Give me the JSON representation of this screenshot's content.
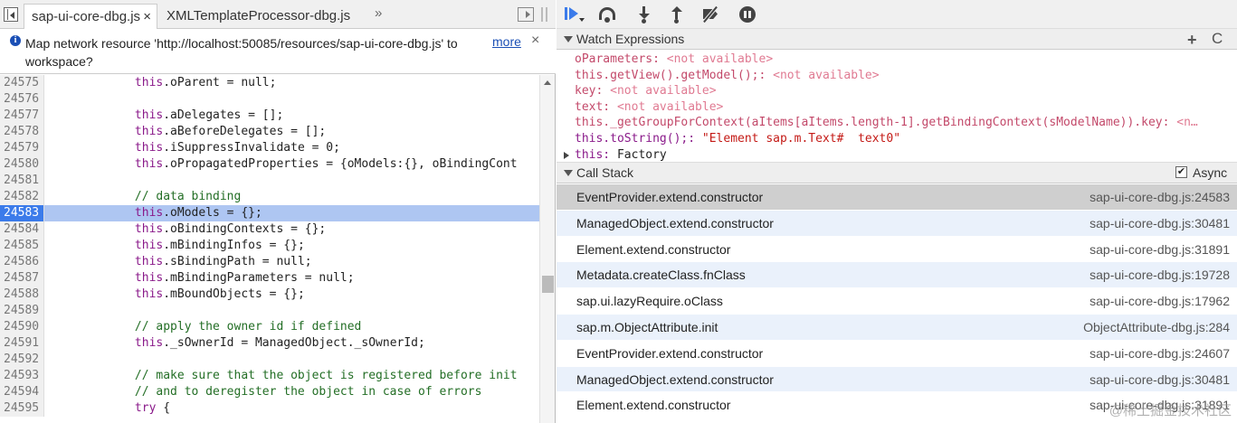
{
  "editor": {
    "tabs": [
      {
        "label": "sap-ui-core-dbg.js",
        "close": "×"
      },
      {
        "label": "XMLTemplateProcessor-dbg.js"
      }
    ],
    "more_tabs": "»",
    "infobar": {
      "message": "Map network resource 'http://localhost:50085/resources/sap-ui-core-dbg.js' to workspace?",
      "more_link": "more",
      "close": "×"
    },
    "highlighted_line": "24583",
    "lines": [
      {
        "n": "24575",
        "code": "            this.oParent = null;"
      },
      {
        "n": "24576",
        "code": ""
      },
      {
        "n": "24577",
        "code": "            this.aDelegates = [];"
      },
      {
        "n": "24578",
        "code": "            this.aBeforeDelegates = [];"
      },
      {
        "n": "24579",
        "code": "            this.iSuppressInvalidate = 0;"
      },
      {
        "n": "24580",
        "code": "            this.oPropagatedProperties = {oModels:{}, oBindingCont"
      },
      {
        "n": "24581",
        "code": ""
      },
      {
        "n": "24582",
        "code": "            // data binding"
      },
      {
        "n": "24583",
        "code": "            this.oModels = {};"
      },
      {
        "n": "24584",
        "code": "            this.oBindingContexts = {};"
      },
      {
        "n": "24585",
        "code": "            this.mBindingInfos = {};"
      },
      {
        "n": "24586",
        "code": "            this.sBindingPath = null;"
      },
      {
        "n": "24587",
        "code": "            this.mBindingParameters = null;"
      },
      {
        "n": "24588",
        "code": "            this.mBoundObjects = {};"
      },
      {
        "n": "24589",
        "code": ""
      },
      {
        "n": "24590",
        "code": "            // apply the owner id if defined"
      },
      {
        "n": "24591",
        "code": "            this._sOwnerId = ManagedObject._sOwnerId;"
      },
      {
        "n": "24592",
        "code": ""
      },
      {
        "n": "24593",
        "code": "            // make sure that the object is registered before init"
      },
      {
        "n": "24594",
        "code": "            // and to deregister the object in case of errors"
      },
      {
        "n": "24595",
        "code": "            try {"
      }
    ]
  },
  "debugger_toolbar": {
    "buttons": [
      {
        "icon": "resume-icon"
      },
      {
        "icon": "step-over-icon"
      },
      {
        "icon": "step-into-icon"
      },
      {
        "icon": "step-out-icon"
      },
      {
        "icon": "deactivate-breakpoints-icon"
      },
      {
        "icon": "pause-on-exceptions-icon"
      }
    ]
  },
  "watch": {
    "title": "Watch Expressions",
    "add": "+",
    "refresh": "C",
    "items": [
      {
        "expr": "oParameters:",
        "value": " <not available>",
        "status": "na"
      },
      {
        "expr": "this.getView().getModel();:",
        "value": " <not available>",
        "status": "na"
      },
      {
        "expr": "key:",
        "value": " <not available>",
        "status": "na"
      },
      {
        "expr": "text:",
        "value": " <not available>",
        "status": "na"
      },
      {
        "expr": "this._getGroupForContext(aItems[aItems.length-1].getBindingContext(sModelName)).key:",
        "value": " <n…",
        "status": "na"
      },
      {
        "expr": "this.toString();:",
        "value": " \"Element sap.m.Text#  text0\"",
        "status": "ok"
      },
      {
        "expr": "this:",
        "value": " Factory",
        "status": "obj"
      }
    ]
  },
  "call_stack": {
    "title": "Call Stack",
    "async_label": "Async",
    "async_checked": true,
    "frames": [
      {
        "name": "EventProvider.extend.constructor",
        "location": "sap-ui-core-dbg.js:24583",
        "selected": true
      },
      {
        "name": "ManagedObject.extend.constructor",
        "location": "sap-ui-core-dbg.js:30481"
      },
      {
        "name": "Element.extend.constructor",
        "location": "sap-ui-core-dbg.js:31891"
      },
      {
        "name": "Metadata.createClass.fnClass",
        "location": "sap-ui-core-dbg.js:19728"
      },
      {
        "name": "sap.ui.lazyRequire.oClass",
        "location": "sap-ui-core-dbg.js:17962"
      },
      {
        "name": "sap.m.ObjectAttribute.init",
        "location": "ObjectAttribute-dbg.js:284"
      },
      {
        "name": "EventProvider.extend.constructor",
        "location": "sap-ui-core-dbg.js:24607"
      },
      {
        "name": "ManagedObject.extend.constructor",
        "location": "sap-ui-core-dbg.js:30481"
      },
      {
        "name": "Element.extend.constructor",
        "location": "sap-ui-core-dbg.js:31891"
      }
    ]
  },
  "watermark": "@稀土掘金技术社区"
}
